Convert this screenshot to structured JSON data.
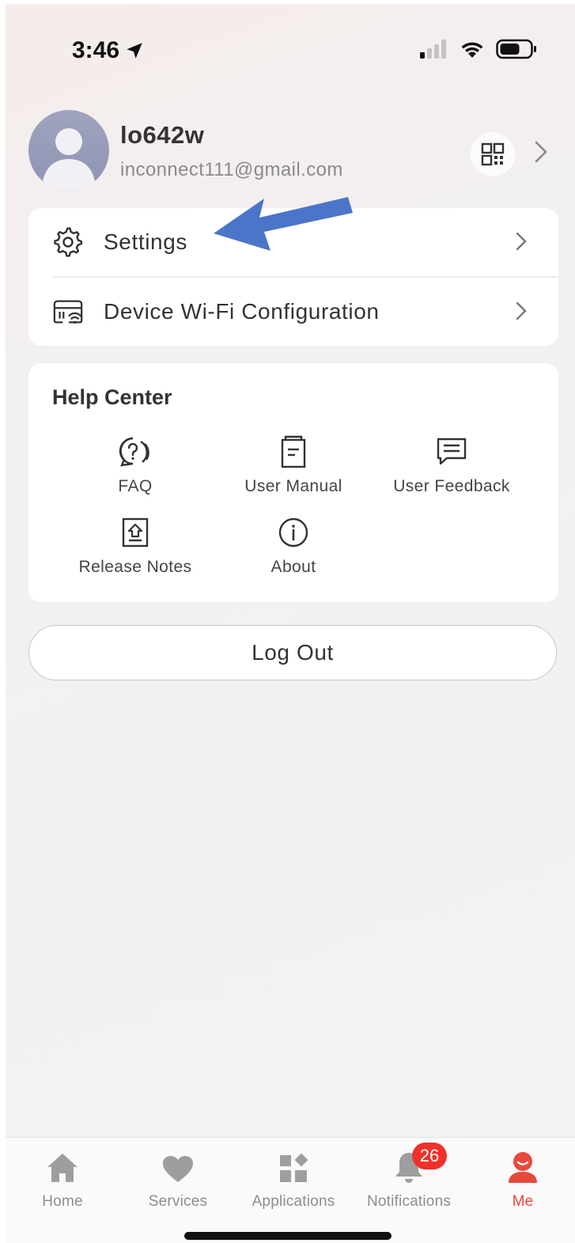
{
  "status_bar": {
    "time": "3:46"
  },
  "profile": {
    "username": "lo642w",
    "email": "inconnect111@gmail.com"
  },
  "menu": {
    "items": [
      {
        "label": "Settings",
        "icon": "gear-icon"
      },
      {
        "label": "Device Wi-Fi Configuration",
        "icon": "router-wifi-icon"
      }
    ]
  },
  "help_center": {
    "title": "Help Center",
    "items": [
      {
        "label": "FAQ",
        "icon": "faq-icon"
      },
      {
        "label": "User Manual",
        "icon": "manual-icon"
      },
      {
        "label": "User Feedback",
        "icon": "feedback-icon"
      },
      {
        "label": "Release Notes",
        "icon": "release-notes-icon"
      },
      {
        "label": "About",
        "icon": "info-icon"
      }
    ]
  },
  "logout_label": "Log Out",
  "tabbar": {
    "tabs": [
      {
        "label": "Home",
        "icon": "home-icon"
      },
      {
        "label": "Services",
        "icon": "heart-icon"
      },
      {
        "label": "Applications",
        "icon": "apps-icon"
      },
      {
        "label": "Notifications",
        "icon": "bell-icon",
        "badge": "26"
      },
      {
        "label": "Me",
        "icon": "me-icon",
        "active": true
      }
    ]
  },
  "colors": {
    "accent": "#e74a3c",
    "badge": "#f0312a",
    "annotation_arrow": "#4a75c9"
  }
}
